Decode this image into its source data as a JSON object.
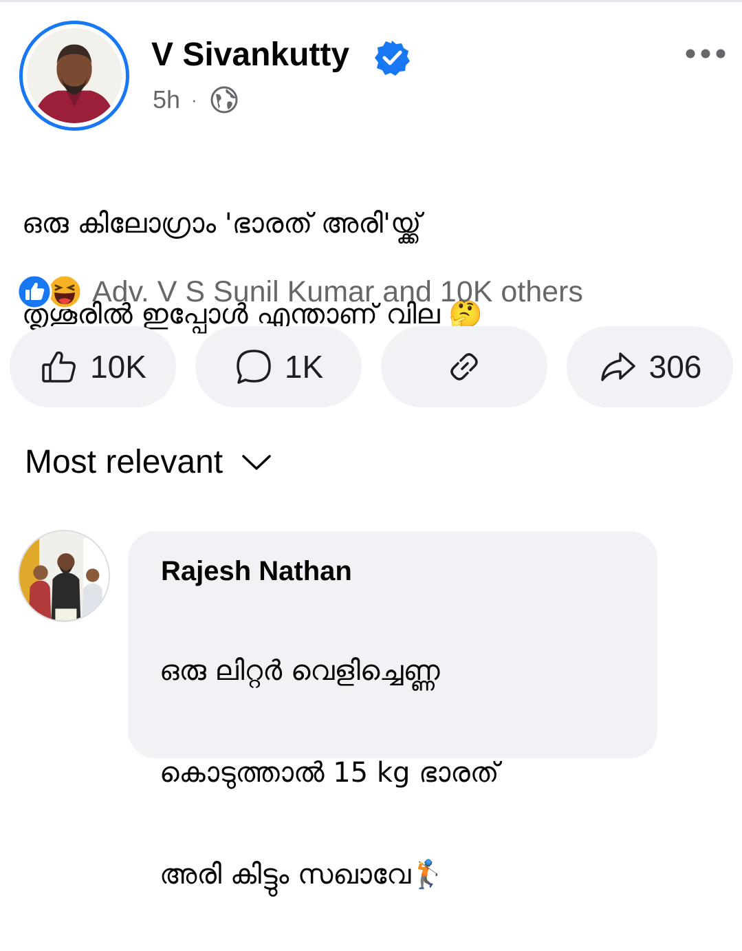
{
  "post": {
    "author": "V Sivankutty",
    "time": "5h",
    "separator": "·",
    "text_line1": "ഒരു കിലോഗ്രാം 'ഭാരത് അരി'യ്ക്ക്",
    "text_line2": "തൃശൂരിൽ ഇപ്പോൾ എന്താണ് വില 🤔",
    "reactions_text": "Adv. V S Sunil Kumar and 10K others"
  },
  "actions": {
    "like_count": "10K",
    "comment_count": "1K",
    "share_count": "306"
  },
  "sort": {
    "label": "Most relevant"
  },
  "comment": {
    "author": "Rajesh Nathan",
    "text_line1": "ഒരു ലിറ്റർ വെളിച്ചെണ്ണ",
    "text_line2": "കൊടുത്താൽ 15 kg ഭാരത്",
    "text_line3": "അരി കിട്ടും സഖാവേ🏌️"
  },
  "colors": {
    "accent": "#1877f2",
    "button_bg": "#f0f2f5",
    "secondary_text": "#65676b"
  },
  "icons": [
    "verified-badge-icon",
    "globe-icon",
    "more-options-icon",
    "like-reaction-icon",
    "haha-reaction-icon",
    "thumbs-up-icon",
    "comment-icon",
    "link-icon",
    "share-arrow-icon",
    "chevron-down-icon"
  ]
}
